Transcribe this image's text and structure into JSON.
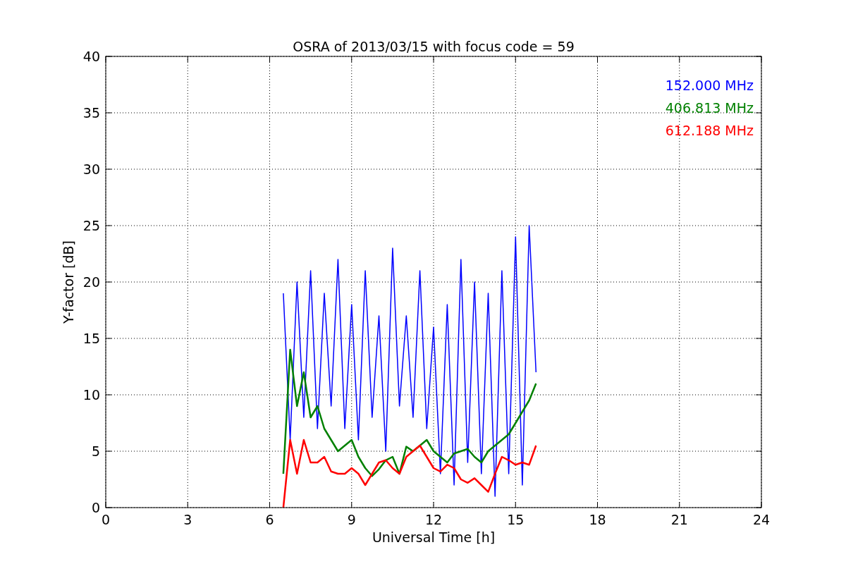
{
  "figure": {
    "chart_data": {
      "type": "line",
      "title": "OSRA of 2013/03/15 with focus code = 59",
      "xlabel": "Universal Time [h]",
      "ylabel": "Y-factor [dB]",
      "grid": true,
      "xlim": [
        0,
        24
      ],
      "ylim": [
        0,
        40
      ],
      "xticks": [
        0,
        3,
        6,
        9,
        12,
        15,
        18,
        21,
        24
      ],
      "yticks": [
        0,
        5,
        10,
        15,
        20,
        25,
        30,
        35,
        40
      ],
      "x": [
        6.5,
        6.75,
        7,
        7.25,
        7.5,
        7.75,
        8,
        8.25,
        8.5,
        8.75,
        9,
        9.25,
        9.5,
        9.75,
        10,
        10.25,
        10.5,
        10.75,
        11,
        11.25,
        11.5,
        11.75,
        12,
        12.25,
        12.5,
        12.75,
        13,
        13.25,
        13.5,
        13.75,
        14,
        14.25,
        14.5,
        14.75,
        15,
        15.25,
        15.5,
        15.75
      ],
      "series": [
        {
          "name": "152.000 MHz",
          "color": "#0000ff",
          "values": [
            19,
            6,
            20,
            8,
            21,
            7,
            19,
            9,
            22,
            7,
            18,
            6,
            21,
            8,
            17,
            5,
            23,
            9,
            17,
            8,
            21,
            7,
            16,
            3,
            18,
            2,
            22,
            4,
            20,
            3,
            19,
            1,
            21,
            3,
            24,
            2,
            25,
            12
          ]
        },
        {
          "name": "406.813 MHz",
          "color": "#008000",
          "values": [
            3,
            14,
            9,
            12,
            8,
            9,
            7,
            6,
            5,
            5.5,
            6,
            4.5,
            3.5,
            2.8,
            3.4,
            4.2,
            4.5,
            3,
            5.4,
            5,
            5.5,
            6,
            5,
            4.5,
            4,
            4.8,
            5,
            5.2,
            4.5,
            4,
            5,
            5.5,
            6,
            6.5,
            7.5,
            8.5,
            9.5,
            11
          ]
        },
        {
          "name": "612.188 MHz",
          "color": "#ff0000",
          "values": [
            0,
            6,
            3,
            6,
            4,
            4,
            4.5,
            3.2,
            3,
            3,
            3.5,
            3,
            2,
            3,
            4,
            4.2,
            3.5,
            3,
            4.5,
            5,
            5.5,
            4.5,
            3.5,
            3.2,
            3.8,
            3.5,
            2.5,
            2.2,
            2.6,
            2,
            1.4,
            3,
            4.5,
            4.2,
            3.8,
            4,
            3.8,
            5.5
          ]
        }
      ]
    }
  }
}
